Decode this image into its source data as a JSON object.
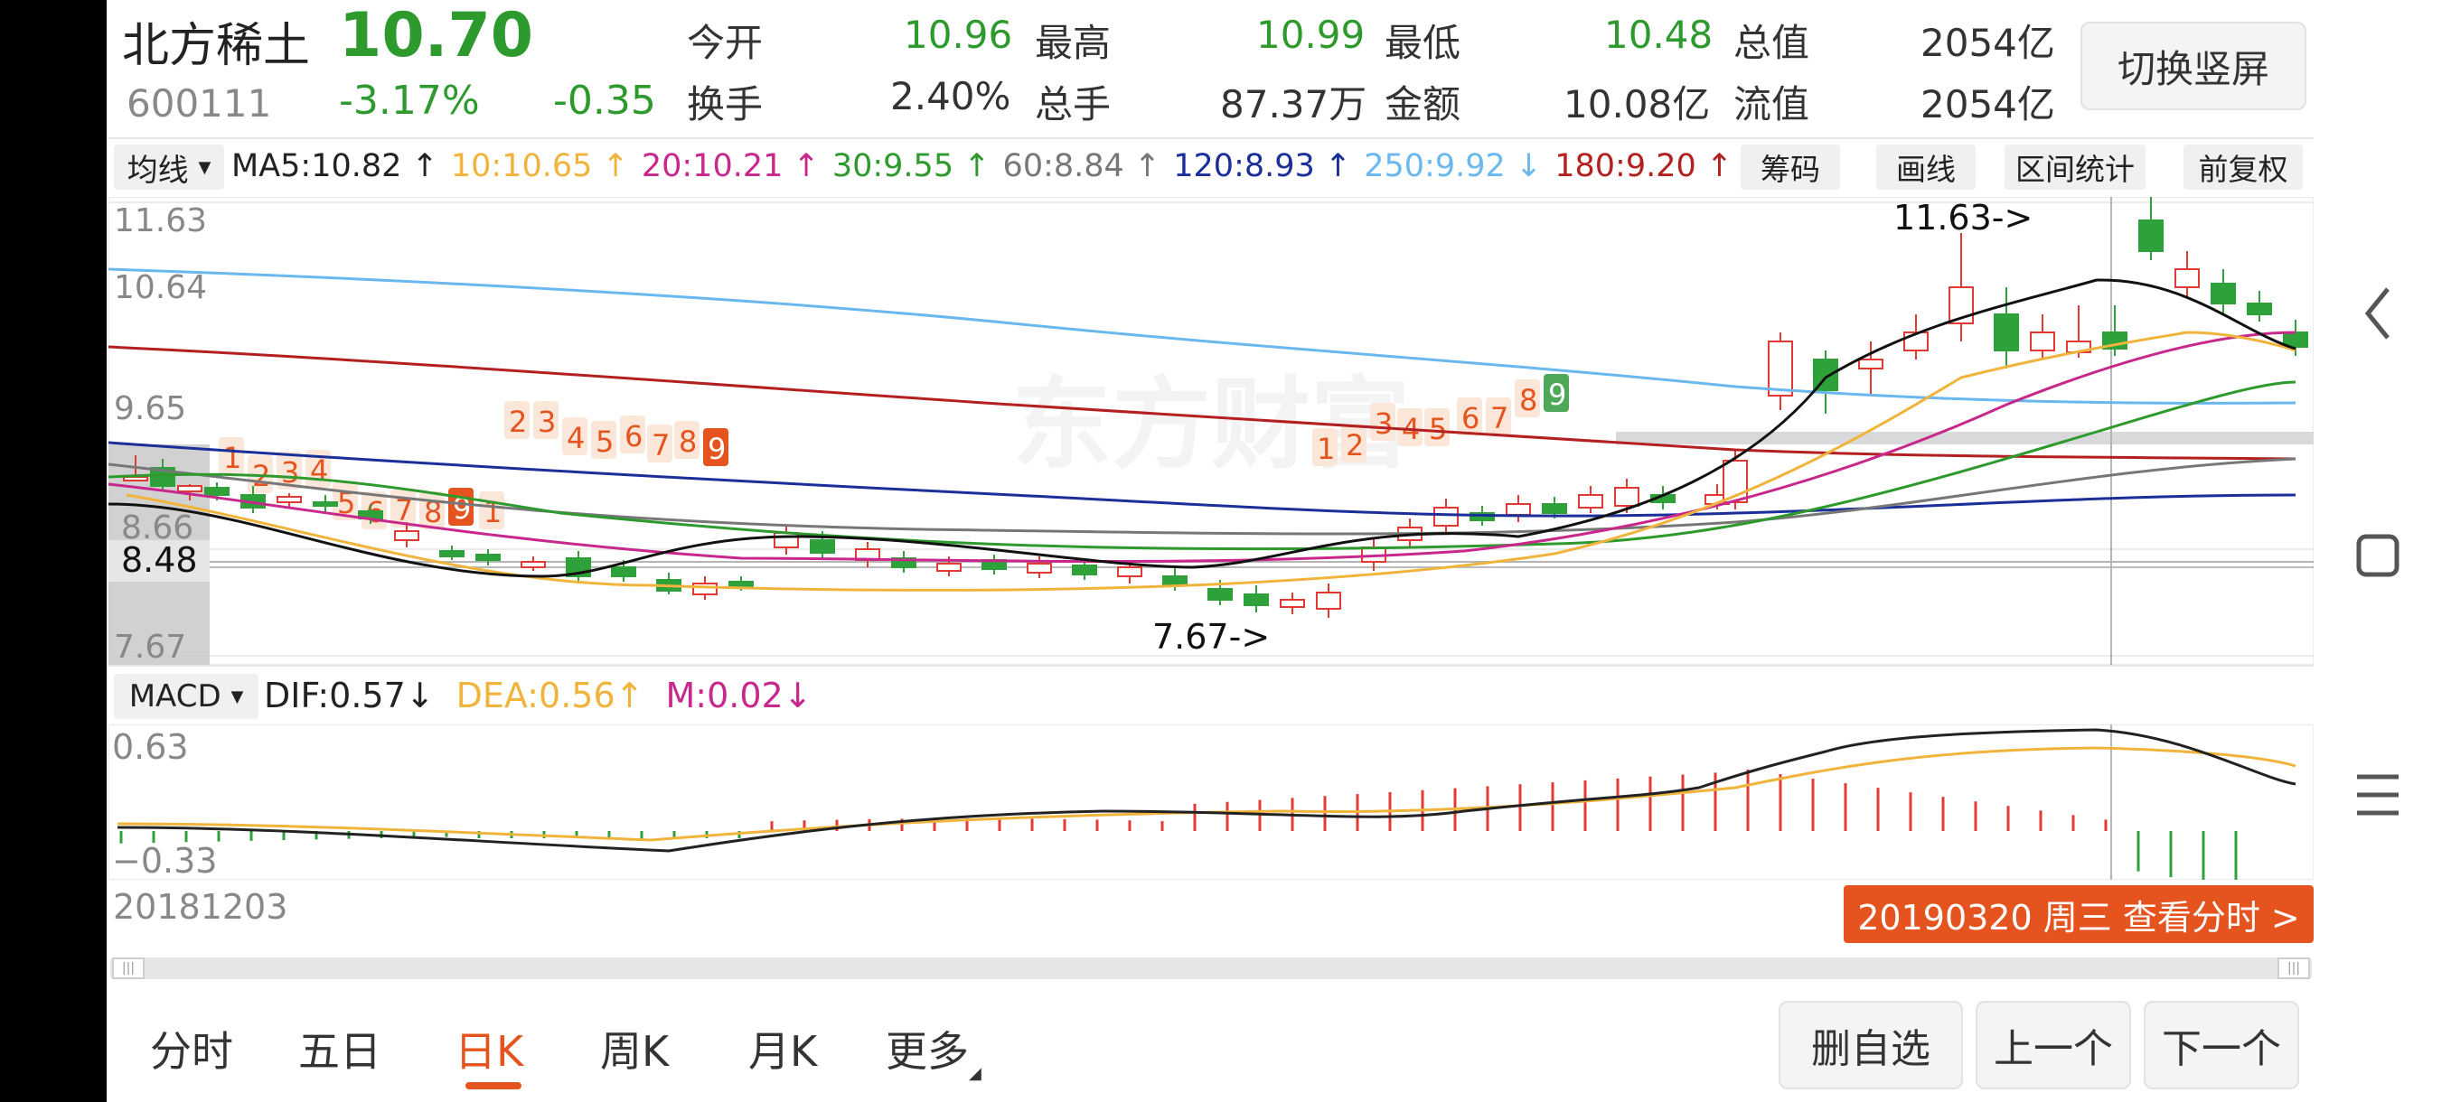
{
  "stock": {
    "name": "北方稀土",
    "price": "10.70",
    "code": "600111",
    "change_pct": "-3.17%",
    "change": "-0.35",
    "switch_label": "切换竖屏",
    "quotes": [
      {
        "label": "今开",
        "value": "10.96"
      },
      {
        "label": "最高",
        "value": "10.99"
      },
      {
        "label": "最低",
        "value": "10.48"
      },
      {
        "label": "总值",
        "value": "2054亿"
      },
      {
        "label": "换手",
        "value": "2.40%"
      },
      {
        "label": "总手",
        "value": "87.37万"
      },
      {
        "label": "金额",
        "value": "10.08亿"
      },
      {
        "label": "流值",
        "value": "2054亿"
      }
    ]
  },
  "ma_bar": {
    "selector": "均线",
    "items": [
      {
        "text": "MA5:10.82",
        "arrow": "↑",
        "color": "#222222"
      },
      {
        "text": "10:10.65",
        "arrow": "↑",
        "color": "#f0b43c"
      },
      {
        "text": "20:10.21",
        "arrow": "↑",
        "color": "#c8288c"
      },
      {
        "text": "30:9.55",
        "arrow": "↑",
        "color": "#2e9a2e"
      },
      {
        "text": "60:8.84",
        "arrow": "↑",
        "color": "#777777"
      },
      {
        "text": "120:8.93",
        "arrow": "↑",
        "color": "#1a2f9a"
      },
      {
        "text": "250:9.92",
        "arrow": "↓",
        "color": "#6ab8ee"
      },
      {
        "text": "180:9.20",
        "arrow": "↑",
        "color": "#b42020"
      }
    ],
    "tools": [
      "筹码",
      "画线",
      "区间统计",
      "前复权"
    ]
  },
  "kline": {
    "y_labels": [
      "11.63",
      "10.64",
      "9.65",
      "8.66",
      "7.67"
    ],
    "crosshair_price": "8.48",
    "high_marker": "11.63->",
    "low_marker": "7.67->",
    "watermark": "东方财富",
    "td_counts": {
      "set_a": [
        "1",
        "2",
        "3",
        "4",
        "5",
        "6",
        "7",
        "8",
        "9",
        "1"
      ],
      "set_b": [
        "2",
        "3",
        "4",
        "5",
        "6",
        "7",
        "8",
        "9"
      ],
      "set_c": [
        "1",
        "2",
        "3",
        "4",
        "5",
        "6",
        "7",
        "8",
        "9"
      ]
    }
  },
  "macd": {
    "selector": "MACD",
    "dif": "DIF:0.57",
    "dif_arrow": "↓",
    "dea": "DEA:0.56",
    "dea_arrow": "↑",
    "m": "M:0.02",
    "m_arrow": "↓",
    "y_top": "0.63",
    "y_bottom": "−0.33",
    "colors": {
      "dif": "#222222",
      "dea": "#f0b43c",
      "m": "#c8288c"
    }
  },
  "timeline": {
    "start_date": "20181203",
    "selected_info": "20190320 周三 查看分时 >"
  },
  "tabs": {
    "items": [
      "分时",
      "五日",
      "日K",
      "周K",
      "月K",
      "更多"
    ],
    "active": "日K"
  },
  "actions": [
    "删自选",
    "上一个",
    "下一个"
  ],
  "nav_icons": [
    "back-icon",
    "home-icon",
    "menu-icon"
  ],
  "colors": {
    "up": "#e23a33",
    "down": "#2fa13a",
    "accent": "#e5541f"
  }
}
